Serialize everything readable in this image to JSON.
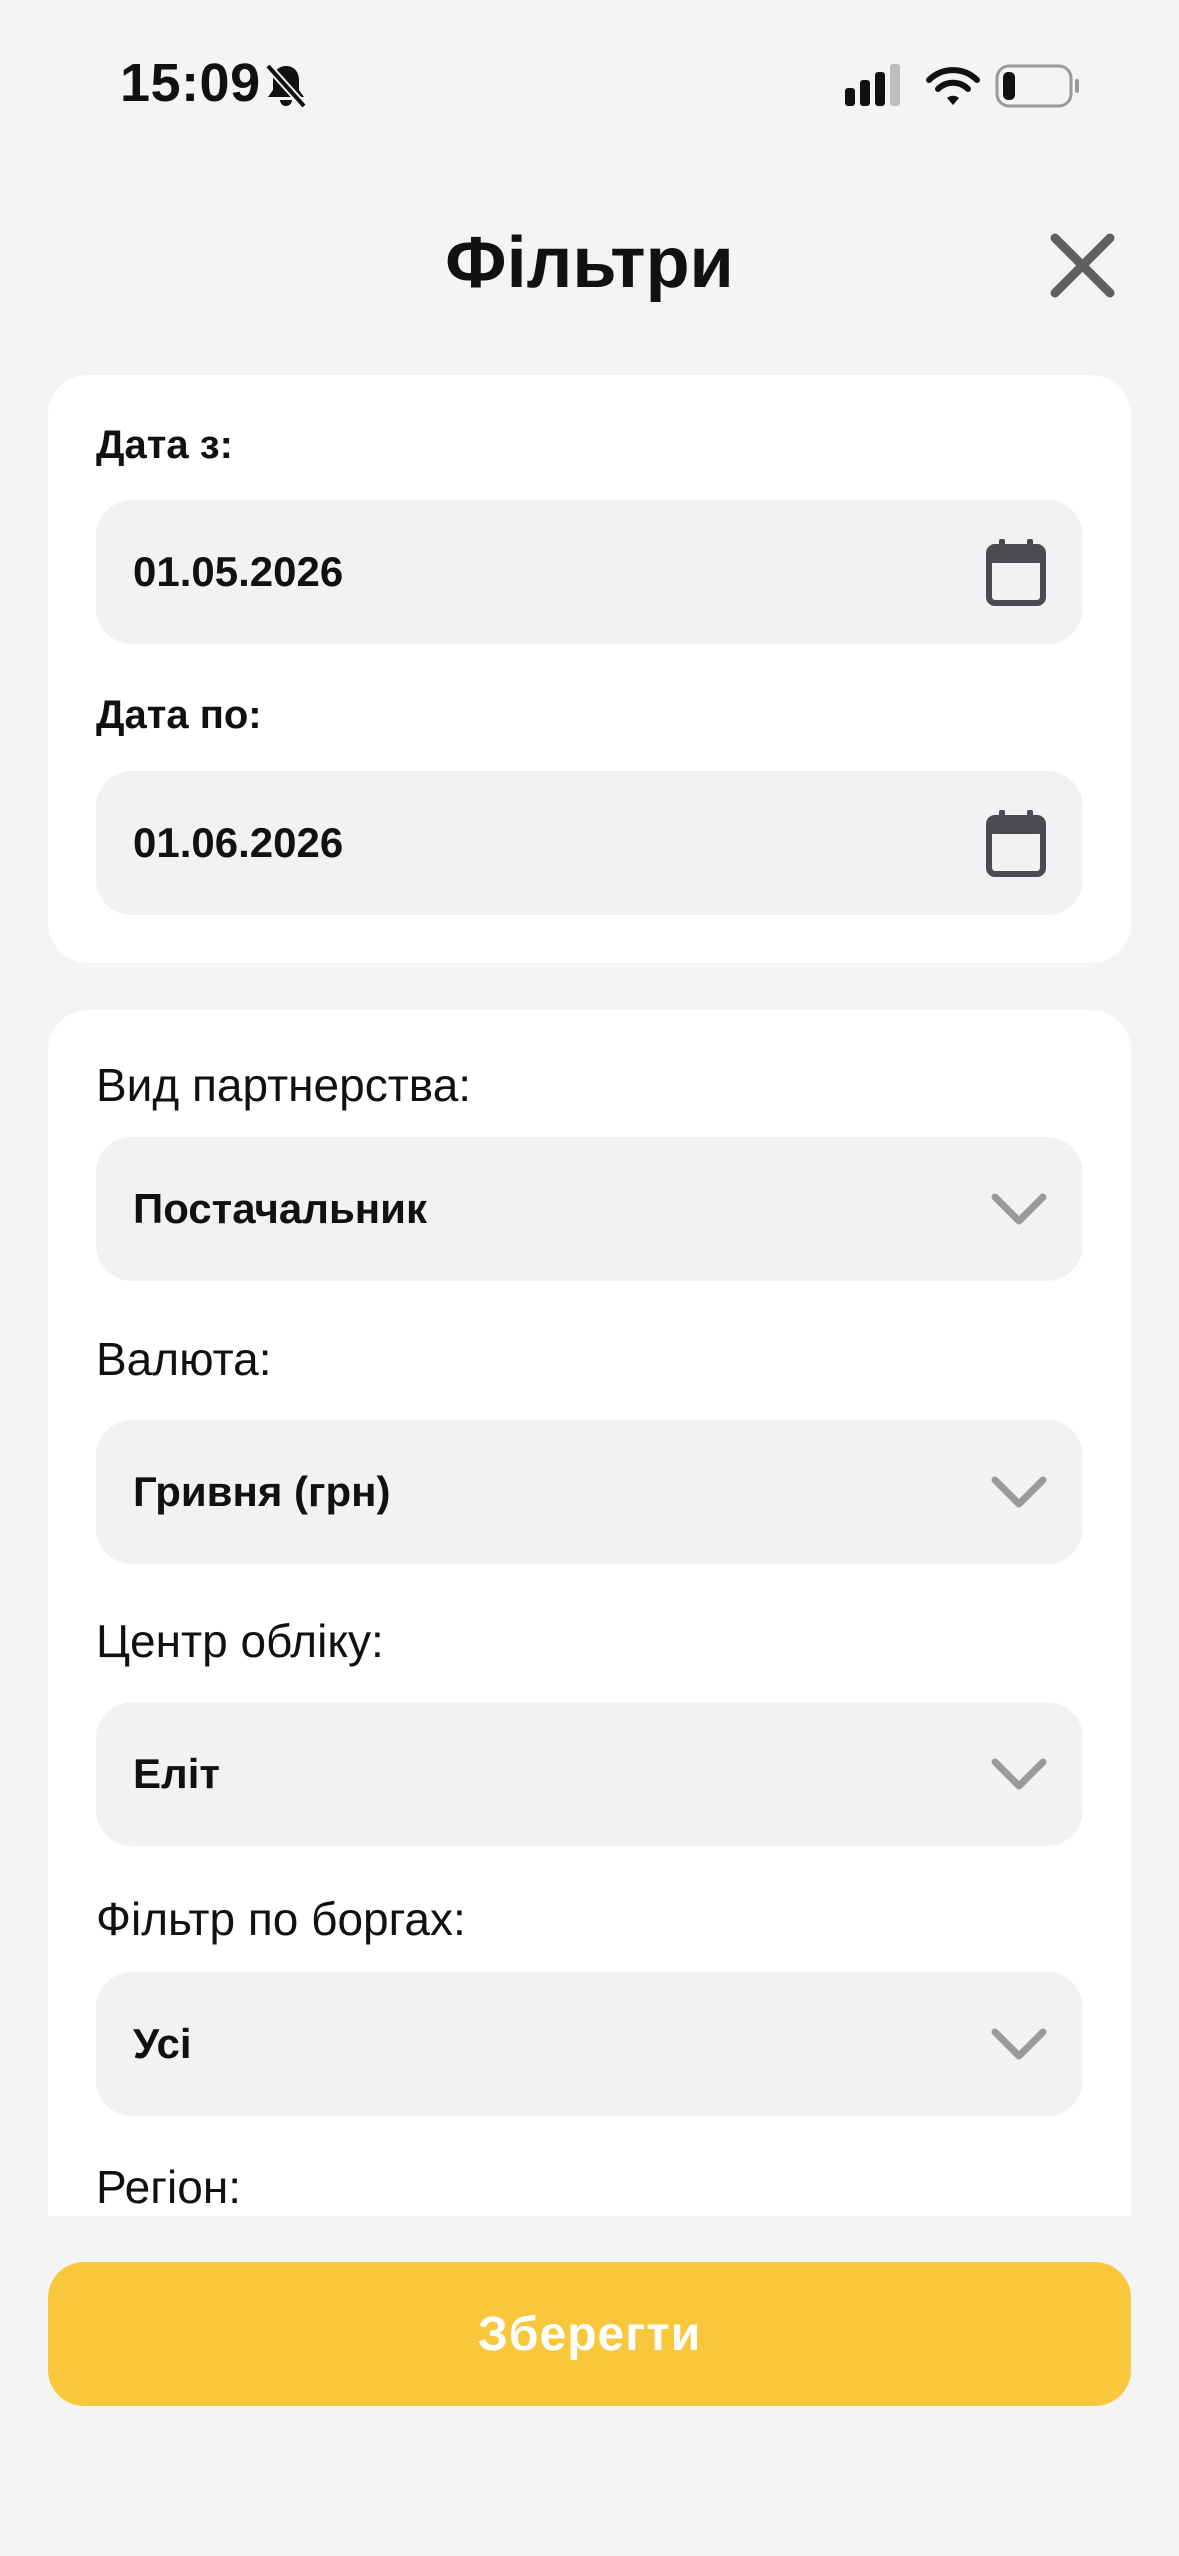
{
  "status_bar": {
    "time": "15:09",
    "icons": [
      "bell-slash-icon",
      "signal-icon",
      "wifi-icon",
      "battery-icon"
    ]
  },
  "header": {
    "title": "Фільтри",
    "close_icon": "close-icon"
  },
  "dates": {
    "from_label": "Дата з:",
    "from_value": "01.05.2026",
    "to_label": "Дата по:",
    "to_value": "01.06.2026",
    "icon": "calendar-icon"
  },
  "filters": {
    "partnership_label": "Вид партнерства:",
    "partnership_value": "Постачальник",
    "currency_label": "Валюта:",
    "currency_value": "Гривня (грн)",
    "center_label": "Центр обліку:",
    "center_value": "Еліт",
    "debt_label": "Фільтр по боргах:",
    "debt_value": "Усі",
    "region_label": "Регіон:",
    "dropdown_icon": "chevron-down-icon"
  },
  "footer": {
    "save_label": "Зберегти"
  },
  "colors": {
    "background": "#f4f4f4",
    "card": "#ffffff",
    "field": "#f1f2f4",
    "accent": "#f9c73b",
    "icon": "#4a4a4f"
  }
}
